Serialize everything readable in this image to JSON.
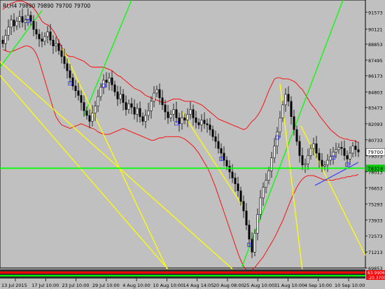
{
  "window": {
    "symbol_line": "RI,H4  79890 79890 79700 79700"
  },
  "colors": {
    "background": "#c0c0c0",
    "plot_background": "#c0c0c0",
    "axis": "#000000",
    "candle_up": "#000000",
    "candle_body": "#000000",
    "band_upper": "#ff0000",
    "band_lower": "#ff0000",
    "band_mid": "#ff0000",
    "trend_green": "#00ff00",
    "trend_yellow": "#ffff00",
    "trend_blue": "#3333ff",
    "marker": "#3333ff",
    "price_label_bg": "#ffffff",
    "level_label_bg": "#00cc00",
    "bottom_stripe_red": "#ff0000",
    "bottom_stripe_dark": "#303030"
  },
  "chart_data": {
    "type": "candlestick",
    "title": "RI,H4",
    "ohlc_header": "79890 79890 79700 79700",
    "y_ticks": [
      "91573",
      "90121",
      "88853",
      "87495",
      "86173",
      "84803",
      "83473",
      "82093",
      "80733",
      "79373",
      "78013",
      "76653",
      "75293",
      "73933",
      "72573",
      "71213",
      "69853"
    ],
    "x_ticks": [
      "13 Jul 2015",
      "17 Jul 10:00",
      "23 Jul 10:00",
      "29 Jul 10:00",
      "4 Aug 10:00",
      "10 Aug 10:00",
      "14 Aug 14:05",
      "20 Aug 08:00",
      "25 Aug 10:00",
      "31 Aug 10:00",
      "4 Sep 10:00",
      "10 Sep 10:00"
    ],
    "ylim": [
      69853,
      92600
    ],
    "current_price_label": "79700",
    "level_label": "78324",
    "bottom_labels": [
      "63.9906",
      "-20.3709"
    ],
    "closes": [
      88900,
      89600,
      90300,
      90900,
      90400,
      90800,
      91200,
      90700,
      90900,
      91300,
      90800,
      90100,
      89700,
      89300,
      89100,
      89500,
      89900,
      89200,
      88700,
      88900,
      88300,
      87800,
      87200,
      86600,
      86000,
      85300,
      84900,
      84500,
      83900,
      83200,
      82800,
      82300,
      83000,
      83600,
      84400,
      85200,
      85800,
      85600,
      86000,
      85400,
      84800,
      84200,
      84600,
      83900,
      83300,
      83800,
      83500,
      82900,
      83400,
      82700,
      82300,
      82800,
      83200,
      84000,
      84700,
      85000,
      84300,
      83700,
      83100,
      82600,
      82900,
      83300,
      82600,
      82100,
      82600,
      82400,
      82900,
      83300,
      82600,
      82200,
      82000,
      82400,
      82100,
      82000,
      81600,
      81000,
      80600,
      80000,
      79600,
      79000,
      78500,
      78000,
      77500,
      77000,
      76400,
      75500,
      74700,
      73500,
      72300,
      71200,
      72800,
      74400,
      75800,
      76700,
      77300,
      78100,
      79200,
      80200,
      81400,
      82600,
      83700,
      84600,
      84000,
      82700,
      81600,
      80600,
      79400,
      78600,
      78700,
      79400,
      80000,
      80400,
      79600,
      79000,
      78500,
      78600,
      79000,
      79300,
      79700,
      79900,
      80100,
      80000,
      79400,
      79100,
      79600,
      80200,
      79900,
      79700
    ],
    "upper_band": [
      91800,
      92000,
      92200,
      92300,
      92400,
      92500,
      92500,
      92500,
      92400,
      92300,
      92100,
      91900,
      91600,
      91200,
      90800,
      90600,
      90500,
      90300,
      90000,
      89600,
      89100,
      88600,
      88200,
      87900,
      87800,
      87800,
      87700,
      87600,
      87500,
      87400,
      87200,
      87000,
      86900,
      86900,
      86900,
      86900,
      86900,
      86800,
      86700,
      86600,
      86400,
      86200,
      86100,
      85900,
      85700,
      85500,
      85300,
      85100,
      85000,
      84900,
      84700,
      84500,
      84400,
      84300,
      84200,
      84100,
      84000,
      83900,
      83900,
      84000,
      84100,
      84200,
      84200,
      84200,
      84100,
      84000,
      84000,
      84000,
      84000,
      83900,
      83800,
      83700,
      83500,
      83300,
      83100,
      82900,
      82700,
      82500,
      82400,
      82300,
      82200,
      82100,
      82000,
      81900,
      81800,
      81700,
      81600,
      81700,
      82000,
      82300,
      82500,
      82800,
      83200,
      83700,
      84300,
      84900,
      85400,
      85900,
      86000,
      86000,
      85900,
      85900,
      85900,
      85800,
      85700,
      85500,
      85200,
      85000,
      84600,
      84200,
      83800,
      83500,
      83200,
      82800,
      82500,
      82200,
      81900,
      81600,
      81400,
      81200,
      81000,
      80900,
      80800,
      80800,
      80700,
      80700,
      80600,
      80500
    ],
    "lower_band": [
      88400,
      88300,
      88200,
      88200,
      88300,
      88400,
      88500,
      88600,
      88700,
      88700,
      88600,
      88400,
      88000,
      87400,
      86600,
      85800,
      85000,
      84200,
      83400,
      82700,
      82300,
      82000,
      81900,
      81800,
      81700,
      81800,
      81900,
      82000,
      82100,
      82000,
      81900,
      81800,
      81700,
      81600,
      81400,
      81300,
      81200,
      81200,
      81200,
      81300,
      81400,
      81500,
      81600,
      81700,
      81600,
      81500,
      81400,
      81300,
      81200,
      81100,
      81000,
      80900,
      80800,
      80700,
      80700,
      80800,
      80900,
      80900,
      81000,
      81000,
      81000,
      81000,
      81000,
      81000,
      80900,
      80800,
      80600,
      80400,
      80200,
      79900,
      79600,
      79200,
      78800,
      78400,
      77900,
      77300,
      76700,
      76000,
      75300,
      74600,
      73900,
      73200,
      72500,
      71800,
      71100,
      70500,
      70000,
      69700,
      69600,
      69700,
      69900,
      70200,
      70500,
      70800,
      71200,
      71600,
      72000,
      72400,
      72900,
      73400,
      73900,
      74500,
      75100,
      75700,
      76200,
      76700,
      77100,
      77400,
      77600,
      77700,
      77700,
      77700,
      77600,
      77500,
      77400,
      77300,
      77300,
      77300,
      77300,
      77400,
      77400,
      77500,
      77500,
      77600,
      77600,
      77700,
      77700,
      77800
    ],
    "markers_at": [
      9,
      24,
      36,
      62,
      78,
      88,
      98,
      118,
      123
    ],
    "level_value": 78324
  }
}
